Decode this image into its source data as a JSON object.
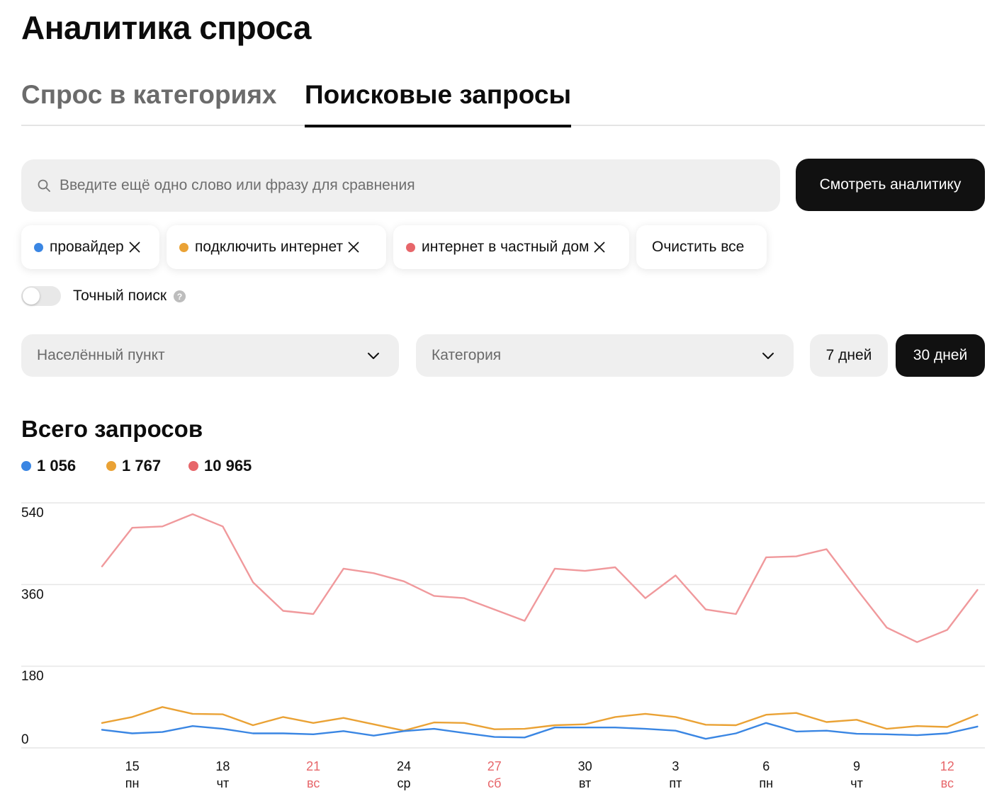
{
  "page_title": "Аналитика спроса",
  "tabs": [
    {
      "label": "Спрос в категориях",
      "active": false
    },
    {
      "label": "Поисковые запросы",
      "active": true
    }
  ],
  "search": {
    "placeholder": "Введите ещё одно слово или фразу для сравнения",
    "value": ""
  },
  "view_button": "Смотреть аналитику",
  "chips": [
    {
      "label": "провайдер",
      "color": "#3a86e3"
    },
    {
      "label": "подключить интернет",
      "color": "#eaa235"
    },
    {
      "label": "интернет в частный дом",
      "color": "#e7666a"
    }
  ],
  "clear_all": "Очистить все",
  "exact_search": {
    "label": "Точный поиск",
    "enabled": false
  },
  "filters": {
    "city_placeholder": "Населённый пункт",
    "category_placeholder": "Категория"
  },
  "periods": [
    {
      "label": "7 дней",
      "active": false
    },
    {
      "label": "30 дней",
      "active": true
    }
  ],
  "section_title": "Всего запросов",
  "totals": [
    {
      "value": "1 056",
      "color": "#3a86e3"
    },
    {
      "value": "1 767",
      "color": "#eaa235"
    },
    {
      "value": "10 965",
      "color": "#e7666a"
    }
  ],
  "chart_data": {
    "type": "line",
    "ylim": [
      0,
      540
    ],
    "y_ticks": [
      "540",
      "360",
      "180",
      "0"
    ],
    "grid": true,
    "x_labels": [
      {
        "day": "15",
        "weekday": "пн",
        "weekend": false,
        "index": 1
      },
      {
        "day": "18",
        "weekday": "чт",
        "weekend": false,
        "index": 4
      },
      {
        "day": "21",
        "weekday": "вс",
        "weekend": true,
        "index": 7
      },
      {
        "day": "24",
        "weekday": "ср",
        "weekend": false,
        "index": 10
      },
      {
        "day": "27",
        "weekday": "сб",
        "weekend": true,
        "index": 13
      },
      {
        "day": "30",
        "weekday": "вт",
        "weekend": false,
        "index": 16
      },
      {
        "day": "3",
        "weekday": "пт",
        "weekend": false,
        "index": 19
      },
      {
        "day": "6",
        "weekday": "пн",
        "weekend": false,
        "index": 22
      },
      {
        "day": "9",
        "weekday": "чт",
        "weekend": false,
        "index": 25
      },
      {
        "day": "12",
        "weekday": "вс",
        "weekend": true,
        "index": 28
      }
    ],
    "weekend_color": "#e7666a",
    "series": [
      {
        "name": "интернет в частный дом",
        "color": "#f0999c",
        "values": [
          400,
          485,
          488,
          515,
          488,
          365,
          302,
          295,
          395,
          385,
          367,
          335,
          330,
          305,
          280,
          395,
          390,
          398,
          330,
          380,
          305,
          295,
          420,
          422,
          438,
          350,
          265,
          233,
          260,
          348
        ]
      },
      {
        "name": "подключить интернет",
        "color": "#eaa235",
        "values": [
          55,
          68,
          90,
          75,
          74,
          50,
          68,
          55,
          66,
          52,
          38,
          56,
          55,
          41,
          42,
          50,
          52,
          68,
          75,
          68,
          51,
          50,
          73,
          77,
          57,
          62,
          42,
          48,
          46,
          73
        ]
      },
      {
        "name": "провайдер",
        "color": "#3a86e3",
        "values": [
          40,
          32,
          35,
          48,
          42,
          32,
          32,
          30,
          37,
          27,
          37,
          42,
          33,
          24,
          23,
          45,
          45,
          45,
          42,
          38,
          20,
          32,
          55,
          36,
          38,
          31,
          30,
          28,
          32,
          47
        ]
      }
    ]
  }
}
